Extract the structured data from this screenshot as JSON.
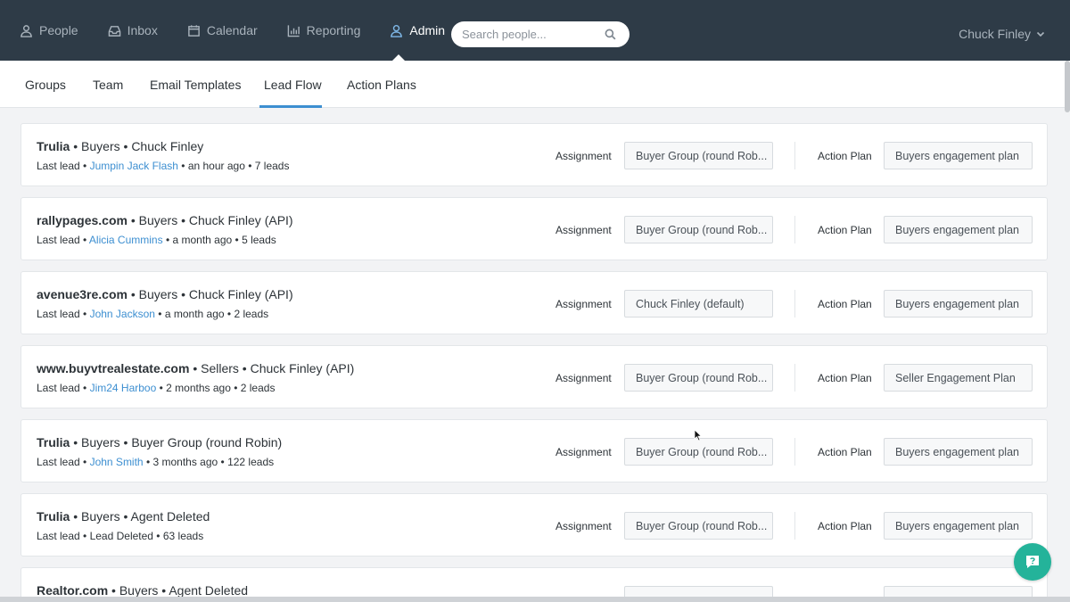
{
  "nav": {
    "items": [
      {
        "label": "People",
        "icon": "people-icon"
      },
      {
        "label": "Inbox",
        "icon": "inbox-icon"
      },
      {
        "label": "Calendar",
        "icon": "calendar-icon"
      },
      {
        "label": "Reporting",
        "icon": "reporting-icon"
      },
      {
        "label": "Admin",
        "icon": "admin-icon"
      }
    ],
    "active": "Admin"
  },
  "search": {
    "placeholder": "Search people..."
  },
  "user": {
    "name": "Chuck Finley"
  },
  "subnav": {
    "tabs": [
      "Groups",
      "Team",
      "Email Templates",
      "Lead Flow",
      "Action Plans"
    ],
    "active": "Lead Flow"
  },
  "labels": {
    "assignment": "Assignment",
    "action_plan": "Action Plan",
    "last_lead": "Last lead",
    "bullet": " • "
  },
  "lead_flows": [
    {
      "source": "Trulia",
      "type": "Buyers",
      "owner": "Chuck Finley",
      "last_lead": "Jumpin Jack Flash",
      "last_lead_is_link": true,
      "when": "an hour ago",
      "leads": "7 leads",
      "assignment": "Buyer Group (round Rob...",
      "action_plan": "Buyers engagement plan"
    },
    {
      "source": "rallypages.com",
      "type": "Buyers",
      "owner": "Chuck Finley (API)",
      "last_lead": "Alicia Cummins",
      "last_lead_is_link": true,
      "when": "a month ago",
      "leads": "5 leads",
      "assignment": "Buyer Group (round Rob...",
      "action_plan": "Buyers engagement plan"
    },
    {
      "source": "avenue3re.com",
      "type": "Buyers",
      "owner": "Chuck Finley (API)",
      "last_lead": "John Jackson",
      "last_lead_is_link": true,
      "when": "a month ago",
      "leads": "2 leads",
      "assignment": "Chuck Finley (default)",
      "action_plan": "Buyers engagement plan"
    },
    {
      "source": "www.buyvtrealestate.com",
      "type": "Sellers",
      "owner": "Chuck Finley (API)",
      "last_lead": "Jim24 Harboo",
      "last_lead_is_link": true,
      "when": "2 months ago",
      "leads": "2 leads",
      "assignment": "Buyer Group (round Rob...",
      "action_plan": "Seller Engagement Plan"
    },
    {
      "source": "Trulia",
      "type": "Buyers",
      "owner": "Buyer Group (round Robin)",
      "last_lead": "John Smith",
      "last_lead_is_link": true,
      "when": "3 months ago",
      "leads": "122 leads",
      "assignment": "Buyer Group (round Rob...",
      "action_plan": "Buyers engagement plan"
    },
    {
      "source": "Trulia",
      "type": "Buyers",
      "owner": "Agent Deleted",
      "last_lead": "Lead Deleted",
      "last_lead_is_link": false,
      "when": "",
      "leads": "63 leads",
      "assignment": "Buyer Group (round Rob...",
      "action_plan": "Buyers engagement plan"
    },
    {
      "source": "Realtor.com",
      "type": "Buyers",
      "owner": "Agent Deleted",
      "last_lead": "",
      "last_lead_is_link": false,
      "when": "",
      "leads": "",
      "assignment": "",
      "action_plan": ""
    }
  ]
}
